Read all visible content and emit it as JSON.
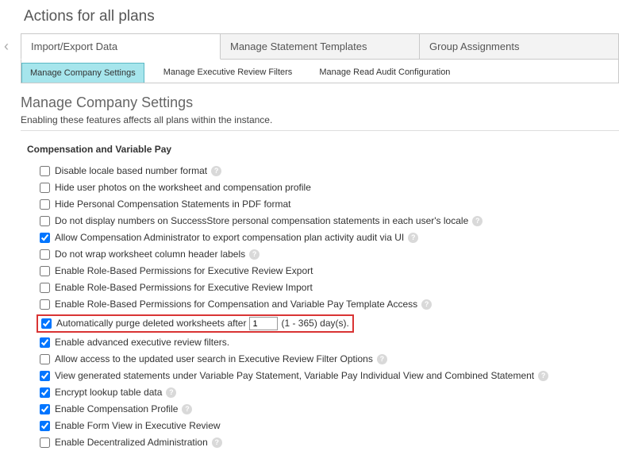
{
  "page_title": "Actions for all plans",
  "tier1_tabs": [
    {
      "label": "Import/Export Data",
      "active": true
    },
    {
      "label": "Manage Statement Templates",
      "active": false
    },
    {
      "label": "Group Assignments",
      "active": false
    }
  ],
  "tier2_tabs": [
    {
      "label": "Manage Company Settings",
      "active": true
    },
    {
      "label": "Manage Executive Review Filters",
      "active": false
    },
    {
      "label": "Manage Read Audit Configuration",
      "active": false
    }
  ],
  "section": {
    "heading": "Manage Company Settings",
    "subtext": "Enabling these features affects all plans within the instance."
  },
  "group": {
    "title": "Compensation and Variable Pay",
    "purge": {
      "prefix": "Automatically purge deleted worksheets after",
      "value": "1",
      "suffix": "(1 - 365) day(s)."
    },
    "options": [
      {
        "label": "Disable locale based number format",
        "checked": false,
        "help": true
      },
      {
        "label": "Hide user photos on the worksheet and compensation profile",
        "checked": false,
        "help": false
      },
      {
        "label": "Hide Personal Compensation Statements in PDF format",
        "checked": false,
        "help": false
      },
      {
        "label": "Do not display numbers on SuccessStore personal compensation statements in each user's locale",
        "checked": false,
        "help": true
      },
      {
        "label": "Allow Compensation Administrator to export compensation plan activity audit via UI",
        "checked": true,
        "help": true
      },
      {
        "label": "Do not wrap worksheet column header labels",
        "checked": false,
        "help": true
      },
      {
        "label": "Enable Role-Based Permissions for Executive Review Export",
        "checked": false,
        "help": false
      },
      {
        "label": "Enable Role-Based Permissions for Executive Review Import",
        "checked": false,
        "help": false
      },
      {
        "label": "Enable Role-Based Permissions for Compensation and Variable Pay Template Access",
        "checked": false,
        "help": true
      },
      {
        "label": "__PURGE_ROW__",
        "checked": true,
        "help": false,
        "highlighted": true
      },
      {
        "label": "Enable advanced executive review filters.",
        "checked": true,
        "help": false
      },
      {
        "label": "Allow access to the updated user search in Executive Review Filter Options",
        "checked": false,
        "help": true
      },
      {
        "label": "View generated statements under Variable Pay Statement, Variable Pay Individual View and Combined Statement",
        "checked": true,
        "help": true
      },
      {
        "label": "Encrypt lookup table data",
        "checked": true,
        "help": true
      },
      {
        "label": "Enable Compensation Profile",
        "checked": true,
        "help": true
      },
      {
        "label": "Enable Form View in Executive Review",
        "checked": true,
        "help": false
      },
      {
        "label": "Enable Decentralized Administration",
        "checked": false,
        "help": true
      }
    ]
  }
}
